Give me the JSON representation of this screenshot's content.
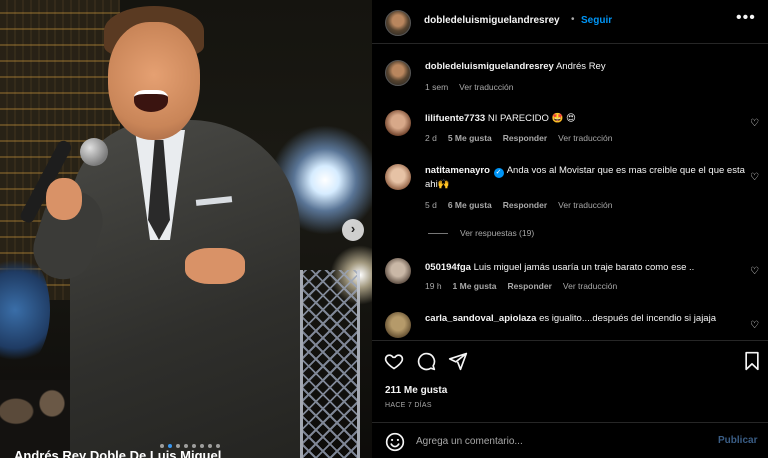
{
  "media": {
    "caption_overlay": "Andrés Rey Doble De Luis Miguel",
    "next_icon": "chevron-right-icon",
    "carousel_dots": 8,
    "carousel_active_index": 1
  },
  "header": {
    "username": "dobledeluismiguelandresrey",
    "separator": "•",
    "follow_label": "Seguir",
    "more_icon": "more-horizontal-icon"
  },
  "post_caption": {
    "username": "dobledeluismiguelandresrey",
    "text": "Andrés Rey",
    "time": "1 sem",
    "translate": "Ver traducción"
  },
  "comments": [
    {
      "username": "lilifuente7733",
      "text": "NI PARECIDO 🤩 😍",
      "time": "2 d",
      "likes": "5 Me gusta",
      "reply": "Responder",
      "translate": "Ver traducción"
    },
    {
      "username": "natitamenayro",
      "verified": true,
      "text": "Anda vos al Movistar que es mas creible que el que esta ahi🙌",
      "time": "5 d",
      "likes": "6 Me gusta",
      "reply": "Responder",
      "translate": "Ver traducción",
      "view_replies": "Ver respuestas (19)"
    },
    {
      "username": "050194fga",
      "text": "Luis miguel jamás usaría un traje barato como ese ..",
      "time": "19 h",
      "likes": "1 Me gusta",
      "reply": "Responder",
      "translate": "Ver traducción"
    },
    {
      "username": "carla_sandoval_apiolaza",
      "text": "es igualito....después del incendio si jajaja"
    }
  ],
  "actions": {
    "like_icon": "heart-icon",
    "comment_icon": "comment-icon",
    "share_icon": "share-icon",
    "save_icon": "bookmark-icon",
    "likes_count": "211 Me gusta",
    "date": "HACE 7 DÍAS"
  },
  "composer": {
    "emoji_icon": "emoji-icon",
    "placeholder": "Agrega un comentario...",
    "post_label": "Publicar"
  },
  "colors": {
    "accent": "#0095f6",
    "background": "#000000",
    "muted_text": "#a8a8a8",
    "divider": "#262626"
  }
}
